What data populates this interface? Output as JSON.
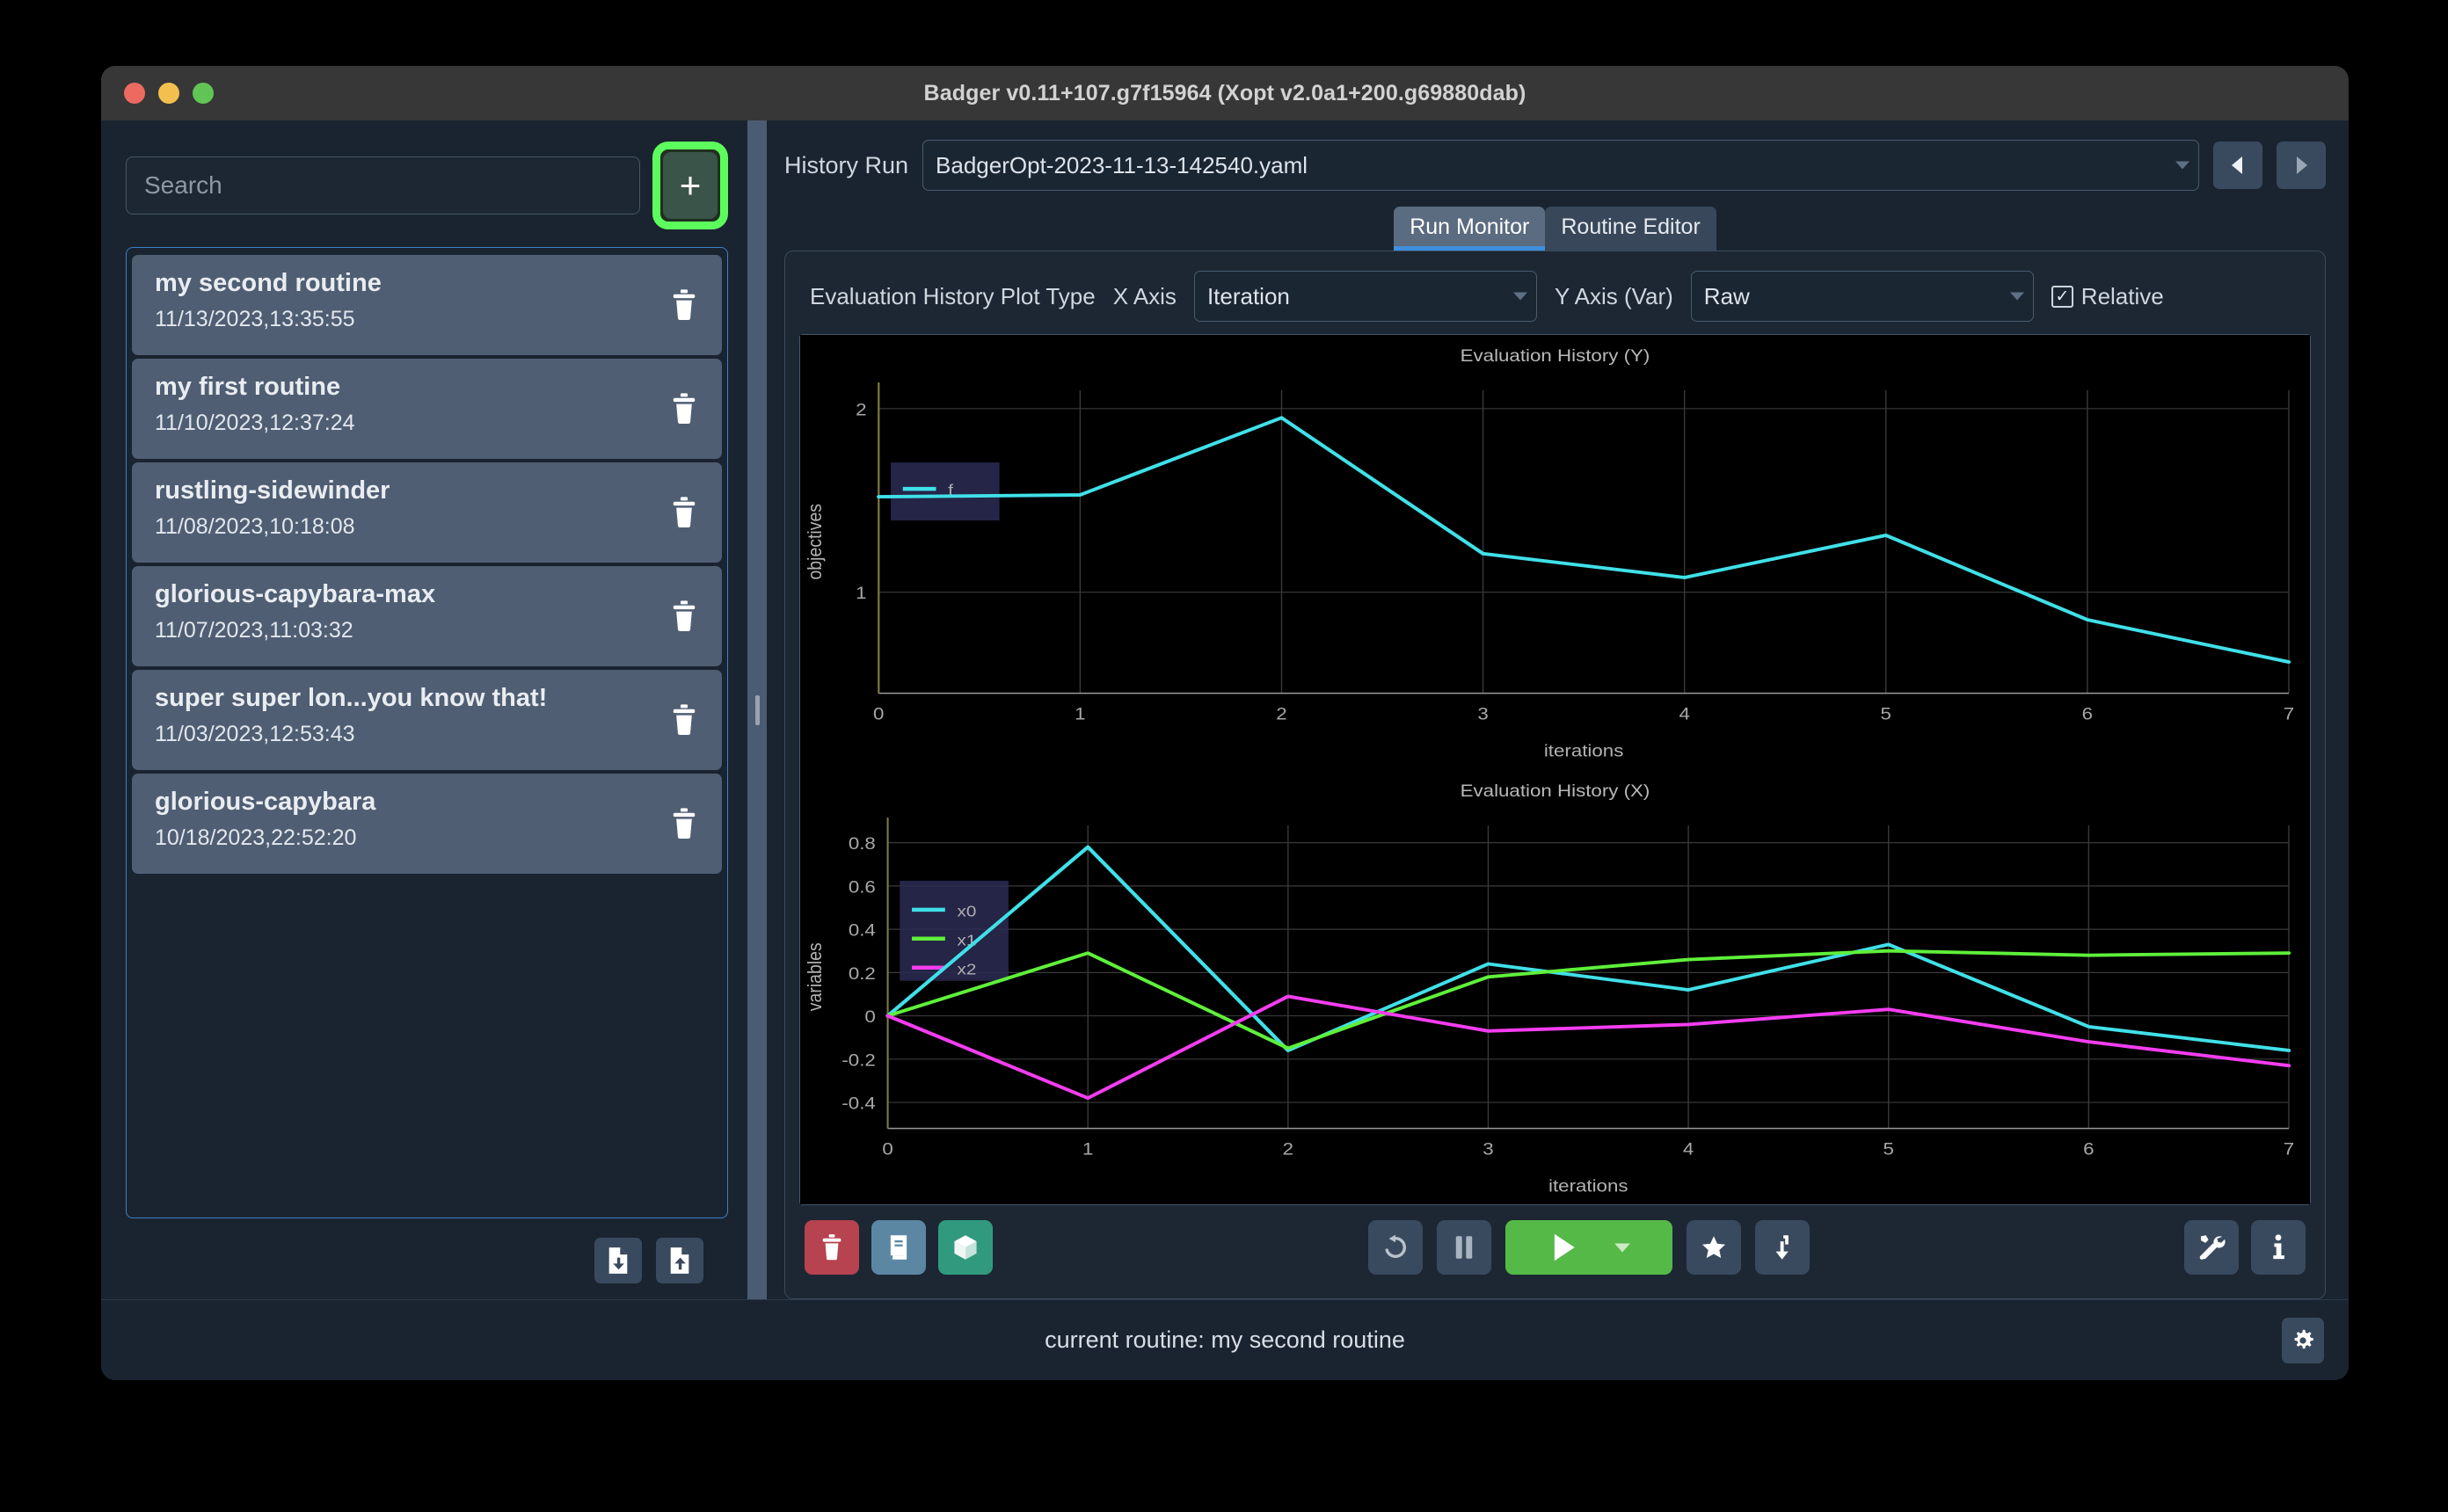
{
  "window": {
    "title": "Badger v0.11+107.g7f15964 (Xopt v2.0a1+200.g69880dab)",
    "traffic_lights": [
      "close-button",
      "minimize-button",
      "zoom-button"
    ]
  },
  "sidebar": {
    "search_placeholder": "Search",
    "search_value": "",
    "add_button_label": "+",
    "add_button_highlight_color": "#5dfc5d",
    "routines": [
      {
        "name": "my second routine",
        "time": "11/13/2023,13:35:55",
        "selected": true
      },
      {
        "name": "my first routine",
        "time": "11/10/2023,12:37:24",
        "selected": false
      },
      {
        "name": "rustling-sidewinder",
        "time": "11/08/2023,10:18:08",
        "selected": false
      },
      {
        "name": "glorious-capybara-max",
        "time": "11/07/2023,11:03:32",
        "selected": false
      },
      {
        "name": "super super lon...you know that!",
        "time": "11/03/2023,12:53:43",
        "selected": false
      },
      {
        "name": "glorious-capybara",
        "time": "10/18/2023,22:52:20",
        "selected": false
      }
    ],
    "footer_buttons": [
      {
        "name": "import-routine-button",
        "icon": "file-download-icon"
      },
      {
        "name": "export-routine-button",
        "icon": "file-upload-icon"
      }
    ]
  },
  "header": {
    "history_run_label": "History Run",
    "history_run_value": "BadgerOpt-2023-11-13-142540.yaml",
    "prev_button": "prev-run-button",
    "next_button": "next-run-button"
  },
  "tabs": [
    {
      "label": "Run Monitor",
      "active": true
    },
    {
      "label": "Routine Editor",
      "active": false
    }
  ],
  "plot_controls": {
    "plot_type_label": "Evaluation History Plot Type",
    "x_axis_label": "X Axis",
    "x_axis_value": "Iteration",
    "y_axis_label": "Y Axis (Var)",
    "y_axis_value": "Raw",
    "relative_label": "Relative",
    "relative_checked": true,
    "relative_checkmark": "✓"
  },
  "chart_data": [
    {
      "type": "line",
      "title": "Evaluation History (Y)",
      "xlabel": "iterations",
      "ylabel": "objectives",
      "x": [
        0,
        1,
        2,
        3,
        4,
        5,
        6,
        7
      ],
      "xlim": [
        0,
        7
      ],
      "ylim": [
        0.45,
        2.1
      ],
      "xticks": [
        0,
        1,
        2,
        3,
        4,
        5,
        6,
        7
      ],
      "yticks": [
        1,
        2
      ],
      "grid": true,
      "legend_position": "upper-left",
      "series": [
        {
          "name": "f",
          "color": "#40e0e8",
          "values": [
            1.52,
            1.53,
            1.95,
            1.21,
            1.08,
            1.31,
            0.85,
            0.62
          ]
        }
      ]
    },
    {
      "type": "line",
      "title": "Evaluation History (X)",
      "xlabel": "iterations",
      "ylabel": "variables",
      "x": [
        0,
        1,
        2,
        3,
        4,
        5,
        6,
        7
      ],
      "xlim": [
        0,
        7
      ],
      "ylim": [
        -0.52,
        0.88
      ],
      "xticks": [
        0,
        1,
        2,
        3,
        4,
        5,
        6,
        7
      ],
      "yticks": [
        0.8,
        0.6,
        0.4,
        0.2,
        0,
        -0.2,
        -0.4
      ],
      "grid": true,
      "legend_position": "upper-left",
      "series": [
        {
          "name": "x0",
          "color": "#40e0e8",
          "values": [
            0,
            0.78,
            -0.16,
            0.24,
            0.12,
            0.33,
            -0.05,
            -0.16
          ]
        },
        {
          "name": "x1",
          "color": "#5ff03a",
          "values": [
            0,
            0.29,
            -0.15,
            0.18,
            0.26,
            0.3,
            0.28,
            0.29
          ]
        },
        {
          "name": "x2",
          "color": "#f43df0",
          "values": [
            0,
            -0.38,
            0.09,
            -0.07,
            -0.04,
            0.03,
            -0.12,
            -0.23
          ]
        }
      ]
    }
  ],
  "toolbar": {
    "left": [
      {
        "name": "delete-run-button",
        "icon": "trash-icon",
        "color": "#b6434f"
      },
      {
        "name": "logbook-button",
        "icon": "book-icon",
        "color": "#5b87a3"
      },
      {
        "name": "extract-button",
        "icon": "cube-icon",
        "color": "#319a7e"
      }
    ],
    "center": [
      {
        "name": "reset-button",
        "icon": "undo-icon"
      },
      {
        "name": "pause-button",
        "icon": "pause-icon"
      },
      {
        "name": "run-button",
        "icon": "play-icon",
        "color": "#55b947",
        "has_dropdown": true
      },
      {
        "name": "favorite-button",
        "icon": "star-icon"
      },
      {
        "name": "jump-to-optimum-button",
        "icon": "arrow-down-hook-icon"
      }
    ],
    "right": [
      {
        "name": "tools-button",
        "icon": "wrench-screwdriver-icon"
      },
      {
        "name": "info-button",
        "icon": "info-icon"
      }
    ]
  },
  "statusbar": {
    "text": "current routine: my second routine",
    "settings_button": "settings-gear-icon"
  }
}
